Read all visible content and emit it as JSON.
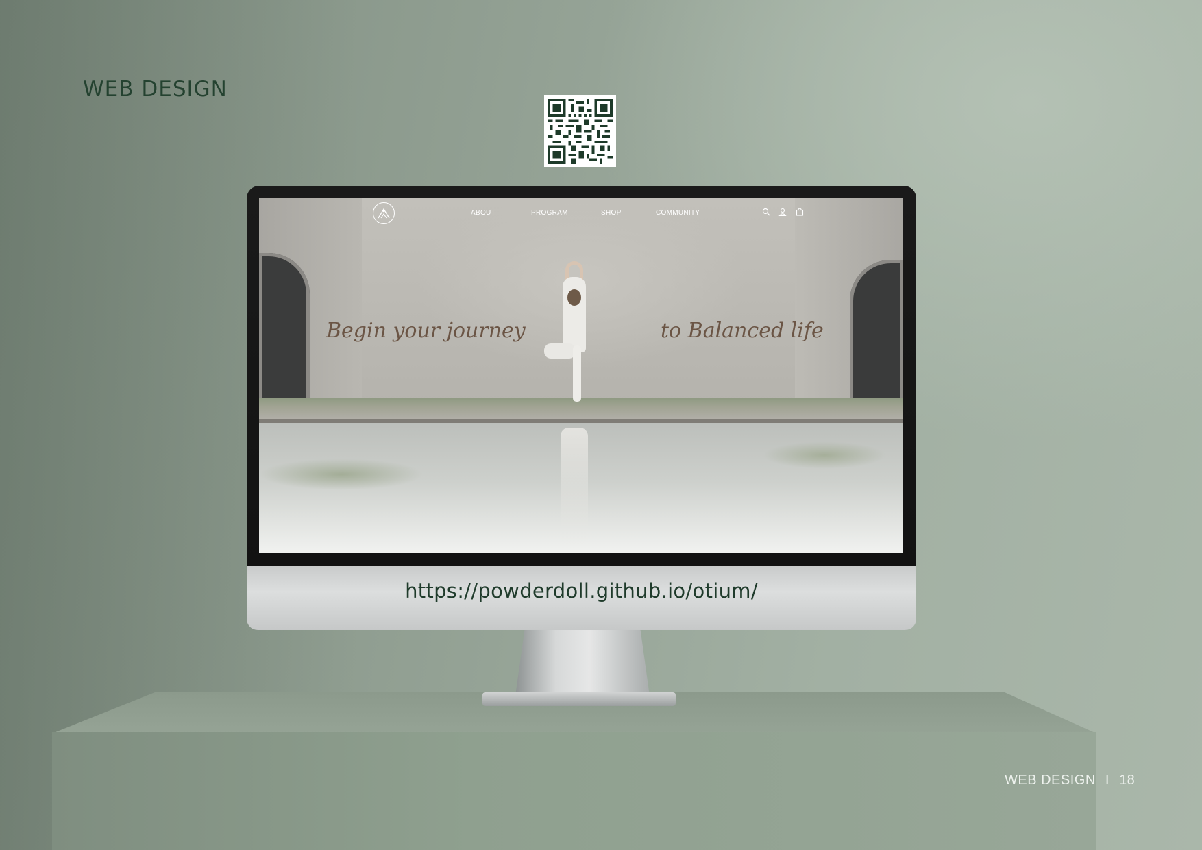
{
  "header": {
    "title": "WEB DESIGN"
  },
  "qr_code": {
    "icon": "qr-code-icon"
  },
  "monitor": {
    "url": "https://powderdoll.github.io/otium/"
  },
  "website": {
    "logo_icon": "mountain-logo-icon",
    "nav": [
      {
        "label": "ABOUT"
      },
      {
        "label": "PROGRAM"
      },
      {
        "label": "SHOP"
      },
      {
        "label": "COMMUNITY"
      }
    ],
    "icons": [
      "search-icon",
      "user-icon",
      "cart-icon"
    ],
    "hero": {
      "left_text": "Begin your journey",
      "right_text": "to Balanced life"
    }
  },
  "footer": {
    "section": "WEB DESIGN",
    "separator": "I",
    "page_number": "18"
  },
  "colors": {
    "brand_green": "#244230",
    "hero_text": "#6b5545",
    "background": "#93a194"
  }
}
